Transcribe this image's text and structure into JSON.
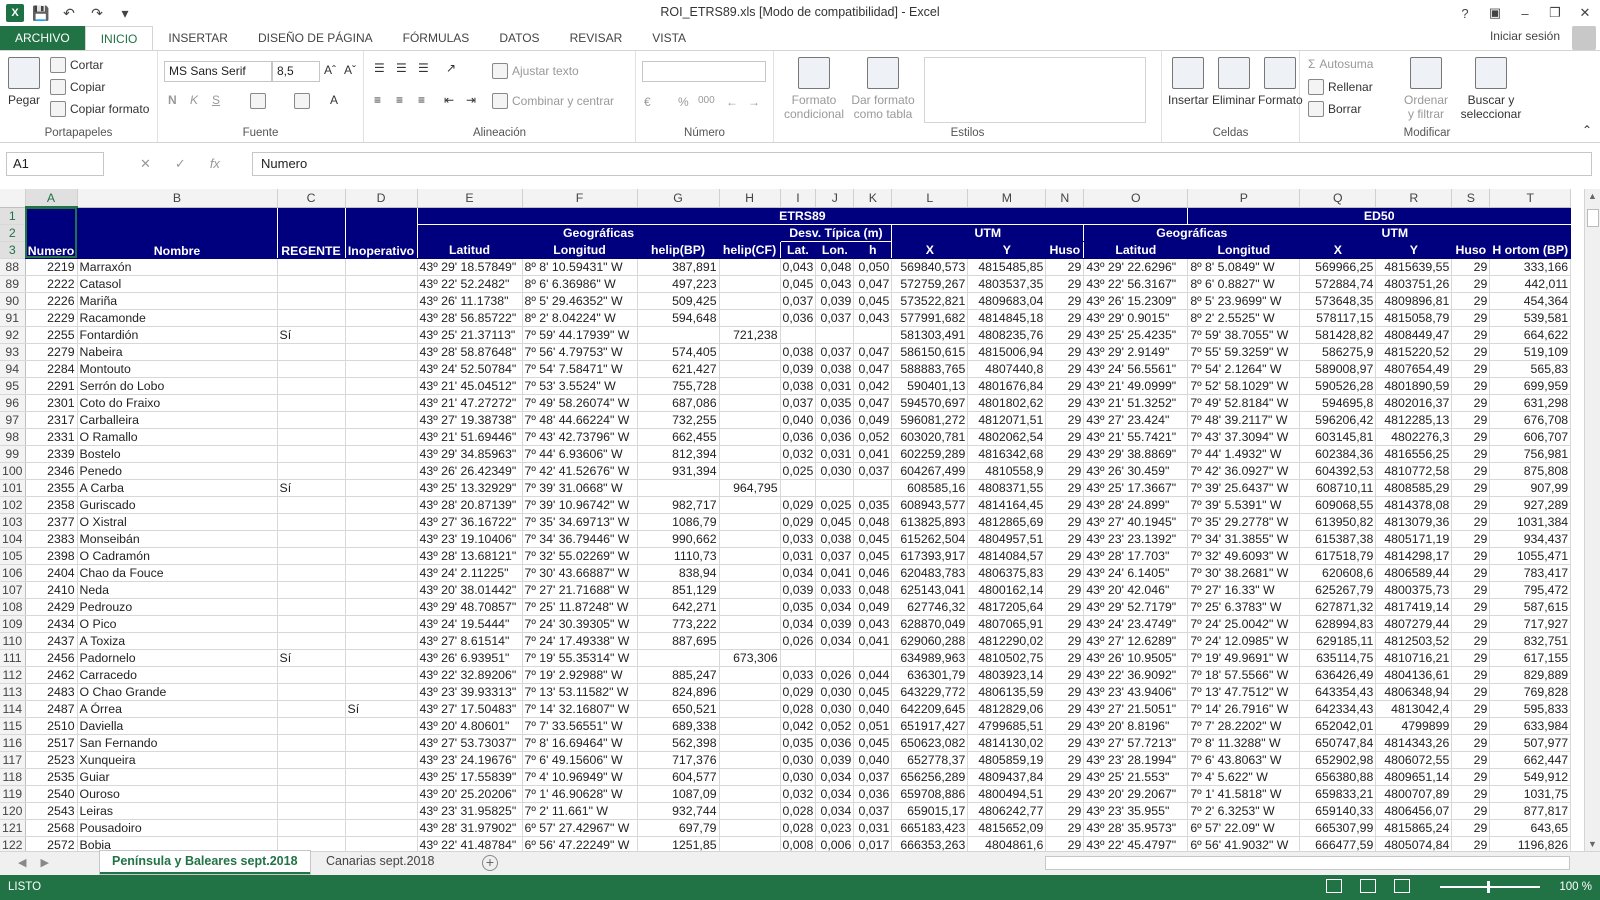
{
  "window": {
    "title": "ROI_ETRS89.xls  [Modo de compatibilidad] - Excel",
    "app_icon": "X"
  },
  "ribbon_tabs": [
    "ARCHIVO",
    "INICIO",
    "INSERTAR",
    "DISEÑO DE PÁGINA",
    "FÓRMULAS",
    "DATOS",
    "REVISAR",
    "VISTA"
  ],
  "signin": "Iniciar sesión",
  "ribbon": {
    "portapapeles": {
      "label": "Portapapeles",
      "pegar": "Pegar",
      "cortar": "Cortar",
      "copiar": "Copiar",
      "copiar_formato": "Copiar formato"
    },
    "fuente": {
      "label": "Fuente",
      "font": "MS Sans Serif",
      "size": "8,5",
      "bold": "N",
      "italic": "K",
      "underline": "S"
    },
    "alineacion": {
      "label": "Alineación",
      "ajustar": "Ajustar texto",
      "combinar": "Combinar y centrar"
    },
    "numero": {
      "label": "Número",
      "percent": "%",
      "thousands": "000"
    },
    "estilos": {
      "label": "Estilos",
      "formato_condicional": "Formato condicional",
      "dar_formato": "Dar formato como tabla"
    },
    "celdas": {
      "label": "Celdas",
      "insertar": "Insertar",
      "eliminar": "Eliminar",
      "formato": "Formato"
    },
    "modificar": {
      "label": "Modificar",
      "autosuma": "Autosuma",
      "rellenar": "Rellenar",
      "borrar": "Borrar",
      "ordenar": "Ordenar y filtrar",
      "buscar": "Buscar y seleccionar"
    }
  },
  "formula_bar": {
    "namebox": "A1",
    "formula": "Numero"
  },
  "columns": [
    "A",
    "B",
    "C",
    "D",
    "E",
    "F",
    "G",
    "H",
    "I",
    "J",
    "K",
    "L",
    "M",
    "N",
    "O",
    "P",
    "Q",
    "R",
    "S",
    "T"
  ],
  "header": {
    "row1": {
      "etrs": "ETRS89",
      "ed": "ED50"
    },
    "row2": {
      "geo1": "Geográficas",
      "desv": "Desv. Típica (m)",
      "utm1": "UTM",
      "geo2": "Geográficas",
      "utm2": "UTM"
    },
    "row3": [
      "Numero",
      "Nombre",
      "REGENTE",
      "Inoperativo",
      "Latitud",
      "Longitud",
      "helip(BP)",
      "helip(CF)",
      "Lat.",
      "Lon.",
      "h",
      "X",
      "Y",
      "Huso",
      "Latitud",
      "Longitud",
      "X",
      "Y",
      "Huso",
      "H ortom (BP)"
    ]
  },
  "rows": [
    [
      88,
      "2219",
      "Marraxón",
      "",
      "",
      "43º 29' 18.57849\"",
      "8º 8' 10.59431\" W",
      "387,891",
      "",
      "0,043",
      "0,048",
      "0,050",
      "569840,573",
      "4815485,85",
      "29",
      "43º 29' 22.6296\"",
      "8º 8' 5.0849\" W",
      "569966,25",
      "4815639,55",
      "29",
      "333,166"
    ],
    [
      89,
      "2222",
      "Catasol",
      "",
      "",
      "43º 22' 52.2482\"",
      "8º 6' 6.36986\" W",
      "497,223",
      "",
      "0,045",
      "0,043",
      "0,047",
      "572759,267",
      "4803537,35",
      "29",
      "43º 22' 56.3167\"",
      "8º 6' 0.8827\" W",
      "572884,74",
      "4803751,26",
      "29",
      "442,011"
    ],
    [
      90,
      "2226",
      "Mariña",
      "",
      "",
      "43º 26' 11.1738\"",
      "8º 5' 29.46352\" W",
      "509,425",
      "",
      "0,037",
      "0,039",
      "0,045",
      "573522,821",
      "4809683,04",
      "29",
      "43º 26' 15.2309\"",
      "8º 5' 23.9699\" W",
      "573648,35",
      "4809896,81",
      "29",
      "454,364"
    ],
    [
      91,
      "2229",
      "Racamonde",
      "",
      "",
      "43º 28' 56.85722\"",
      "8º 2' 8.04224\" W",
      "594,648",
      "",
      "0,036",
      "0,037",
      "0,043",
      "577991,682",
      "4814845,18",
      "29",
      "43º 29' 0.9015\"",
      "8º 2' 2.5525\" W",
      "578117,15",
      "4815058,79",
      "29",
      "539,581"
    ],
    [
      92,
      "2255",
      "Fontardión",
      "Sí",
      "",
      "43º 25' 21.37113\"",
      "7º 59' 44.17939\" W",
      "",
      "721,238",
      "",
      "",
      "",
      "581303,491",
      "4808235,76",
      "29",
      "43º 25' 25.4235\"",
      "7º 59' 38.7055\" W",
      "581428,82",
      "4808449,47",
      "29",
      "664,622"
    ],
    [
      93,
      "2279",
      "Nabeira",
      "",
      "",
      "43º 28' 58.87648\"",
      "7º 56' 4.79753\" W",
      "574,405",
      "",
      "0,038",
      "0,037",
      "0,047",
      "586150,615",
      "4815006,94",
      "29",
      "43º 29' 2.9149\"",
      "7º 55' 59.3259\" W",
      "586275,9",
      "4815220,52",
      "29",
      "519,109"
    ],
    [
      94,
      "2284",
      "Montouto",
      "",
      "",
      "43º 24' 52.50784\"",
      "7º 54' 7.58471\" W",
      "621,427",
      "",
      "0,039",
      "0,038",
      "0,047",
      "588883,765",
      "4807440,8",
      "29",
      "43º 24' 56.5561\"",
      "7º 54' 2.1264\" W",
      "589008,97",
      "4807654,49",
      "29",
      "565,83"
    ],
    [
      95,
      "2291",
      "Serrón do Lobo",
      "",
      "",
      "43º 21' 45.04512\"",
      "7º 53' 3.5524\" W",
      "755,728",
      "",
      "0,038",
      "0,031",
      "0,042",
      "590401,13",
      "4801676,84",
      "29",
      "43º 21' 49.0999\"",
      "7º 52' 58.1029\" W",
      "590526,28",
      "4801890,59",
      "29",
      "699,959"
    ],
    [
      96,
      "2301",
      "Coto do Fraixo",
      "",
      "",
      "43º 21' 47.27272\"",
      "7º 49' 58.26074\" W",
      "687,086",
      "",
      "0,037",
      "0,035",
      "0,047",
      "594570,697",
      "4801802,62",
      "29",
      "43º 21' 51.3252\"",
      "7º 49' 52.8184\" W",
      "594695,8",
      "4802016,37",
      "29",
      "631,298"
    ],
    [
      97,
      "2317",
      "Carballeira",
      "",
      "",
      "43º 27' 19.38738\"",
      "7º 48' 44.66224\" W",
      "732,255",
      "",
      "0,040",
      "0,036",
      "0,049",
      "596081,272",
      "4812071,51",
      "29",
      "43º 27' 23.424\"",
      "7º 48' 39.2117\" W",
      "596206,42",
      "4812285,13",
      "29",
      "676,708"
    ],
    [
      98,
      "2331",
      "O Ramallo",
      "",
      "",
      "43º 21' 51.69446\"",
      "7º 43' 42.73796\" W",
      "662,455",
      "",
      "0,036",
      "0,036",
      "0,052",
      "603020,781",
      "4802062,54",
      "29",
      "43º 21' 55.7421\"",
      "7º 43' 37.3094\" W",
      "603145,81",
      "4802276,3",
      "29",
      "606,707"
    ],
    [
      99,
      "2339",
      "Bostelo",
      "",
      "",
      "43º 29' 34.85963\"",
      "7º 44' 6.93606\" W",
      "812,394",
      "",
      "0,032",
      "0,031",
      "0,041",
      "602259,289",
      "4816342,68",
      "29",
      "43º 29' 38.8869\"",
      "7º 44' 1.4932\" W",
      "602384,36",
      "4816556,25",
      "29",
      "756,981"
    ],
    [
      100,
      "2346",
      "Penedo",
      "",
      "",
      "43º 26' 26.42349\"",
      "7º 42' 41.52676\" W",
      "931,394",
      "",
      "0,025",
      "0,030",
      "0,037",
      "604267,499",
      "4810558,9",
      "29",
      "43º 26' 30.459\"",
      "7º 42' 36.0927\" W",
      "604392,53",
      "4810772,58",
      "29",
      "875,808"
    ],
    [
      101,
      "2355",
      "A Carba",
      "Sí",
      "",
      "43º 25' 13.32929\"",
      "7º 39' 31.0668\" W",
      "",
      "964,795",
      "",
      "",
      "",
      "608585,16",
      "4808371,55",
      "29",
      "43º 25' 17.3667\"",
      "7º 39' 25.6437\" W",
      "608710,11",
      "4808585,29",
      "29",
      "907,99"
    ],
    [
      102,
      "2358",
      "Guriscado",
      "",
      "",
      "43º 28' 20.87139\"",
      "7º 39' 10.96742\" W",
      "982,717",
      "",
      "0,029",
      "0,025",
      "0,035",
      "608943,577",
      "4814164,45",
      "29",
      "43º 28' 24.899\"",
      "7º 39' 5.5391\" W",
      "609068,55",
      "4814378,08",
      "29",
      "927,289"
    ],
    [
      103,
      "2377",
      "O Xistral",
      "",
      "",
      "43º 27' 36.16722\"",
      "7º 35' 34.69713\" W",
      "1086,79",
      "",
      "0,029",
      "0,045",
      "0,048",
      "613825,893",
      "4812865,69",
      "29",
      "43º 27' 40.1945\"",
      "7º 35' 29.2778\" W",
      "613950,82",
      "4813079,36",
      "29",
      "1031,384"
    ],
    [
      104,
      "2383",
      "Monseibán",
      "",
      "",
      "43º 23' 19.10406\"",
      "7º 34' 36.79446\" W",
      "990,662",
      "",
      "0,033",
      "0,038",
      "0,045",
      "615262,504",
      "4804957,51",
      "29",
      "43º 23' 23.1392\"",
      "7º 34' 31.3855\" W",
      "615387,38",
      "4805171,19",
      "29",
      "934,437"
    ],
    [
      105,
      "2398",
      "O Cadramón",
      "",
      "",
      "43º 28' 13.68121\"",
      "7º 32' 55.02269\" W",
      "1110,73",
      "",
      "0,031",
      "0,037",
      "0,045",
      "617393,917",
      "4814084,57",
      "29",
      "43º 28' 17.703\"",
      "7º 32' 49.6093\" W",
      "617518,79",
      "4814298,17",
      "29",
      "1055,471"
    ],
    [
      106,
      "2404",
      "Chao da Fouce",
      "",
      "",
      "43º 24' 2.11225\"",
      "7º 30' 43.66887\" W",
      "838,94",
      "",
      "0,034",
      "0,041",
      "0,046",
      "620483,783",
      "4806375,83",
      "29",
      "43º 24' 6.1405\"",
      "7º 30' 38.2681\" W",
      "620608,6",
      "4806589,44",
      "29",
      "783,417"
    ],
    [
      107,
      "2410",
      "Neda",
      "",
      "",
      "43º 20' 38.01442\"",
      "7º 27' 21.71688\" W",
      "851,129",
      "",
      "0,039",
      "0,033",
      "0,048",
      "625143,041",
      "4800162,14",
      "29",
      "43º 20' 42.046\"",
      "7º 27' 16.33\" W",
      "625267,79",
      "4800375,73",
      "29",
      "795,472"
    ],
    [
      108,
      "2429",
      "Pedrouzo",
      "",
      "",
      "43º 29' 48.70857\"",
      "7º 25' 11.87248\" W",
      "642,271",
      "",
      "0,035",
      "0,034",
      "0,049",
      "627746,32",
      "4817205,64",
      "29",
      "43º 29' 52.7179\"",
      "7º 25' 6.3783\" W",
      "627871,32",
      "4817419,14",
      "29",
      "587,615"
    ],
    [
      109,
      "2434",
      "O Pico",
      "",
      "",
      "43º 24' 19.5444\"",
      "7º 24' 30.39305\" W",
      "773,222",
      "",
      "0,034",
      "0,039",
      "0,043",
      "628870,049",
      "4807065,91",
      "29",
      "43º 24' 23.4749\"",
      "7º 24' 25.0042\" W",
      "628994,83",
      "4807279,44",
      "29",
      "717,927"
    ],
    [
      110,
      "2437",
      "A Toxiza",
      "",
      "",
      "43º 27' 8.61514\"",
      "7º 24' 17.49338\" W",
      "887,695",
      "",
      "0,026",
      "0,034",
      "0,041",
      "629060,288",
      "4812290,02",
      "29",
      "43º 27' 12.6289\"",
      "7º 24' 12.0985\" W",
      "629185,11",
      "4812503,52",
      "29",
      "832,751"
    ],
    [
      111,
      "2456",
      "Padornelo",
      "Sí",
      "",
      "43º 26' 6.93951\"",
      "7º 19' 55.35314\" W",
      "",
      "673,306",
      "",
      "",
      "",
      "634989,963",
      "4810502,75",
      "29",
      "43º 26' 10.9505\"",
      "7º 19' 49.9691\" W",
      "635114,75",
      "4810716,21",
      "29",
      "617,155"
    ],
    [
      112,
      "2462",
      "Carracedo",
      "",
      "",
      "43º 22' 32.89206\"",
      "7º 19' 2.92988\" W",
      "885,247",
      "",
      "0,033",
      "0,026",
      "0,044",
      "636301,79",
      "4803923,14",
      "29",
      "43º 22' 36.9092\"",
      "7º 18' 57.5566\" W",
      "636426,49",
      "4804136,61",
      "29",
      "829,889"
    ],
    [
      113,
      "2483",
      "O Chao Grande",
      "",
      "",
      "43º 23' 39.93313\"",
      "7º 13' 53.11582\" W",
      "824,896",
      "",
      "0,029",
      "0,030",
      "0,045",
      "643229,772",
      "4806135,59",
      "29",
      "43º 23' 43.9406\"",
      "7º 13' 47.7512\" W",
      "643354,43",
      "4806348,94",
      "29",
      "769,828"
    ],
    [
      114,
      "2487",
      "A Órrea",
      "",
      "Sí",
      "43º 27' 17.50483\"",
      "7º 14' 32.16807\" W",
      "650,521",
      "",
      "0,028",
      "0,030",
      "0,040",
      "642209,645",
      "4812829,06",
      "29",
      "43º 27' 21.5051\"",
      "7º 14' 26.7916\" W",
      "642334,43",
      "4813042,4",
      "29",
      "595,833"
    ],
    [
      115,
      "2510",
      "Daviella",
      "",
      "",
      "43º 20' 4.80601\"",
      "7º 7' 33.56551\" W",
      "689,338",
      "",
      "0,042",
      "0,052",
      "0,051",
      "651917,427",
      "4799685,51",
      "29",
      "43º 20' 8.8196\"",
      "7º 7' 28.2202\" W",
      "652042,01",
      "4799899",
      "29",
      "633,984"
    ],
    [
      116,
      "2517",
      "San Fernando",
      "",
      "",
      "43º 27' 53.73037\"",
      "7º 8' 16.69464\" W",
      "562,398",
      "",
      "0,035",
      "0,036",
      "0,045",
      "650623,082",
      "4814130,02",
      "29",
      "43º 27' 57.7213\"",
      "7º 8' 11.3288\" W",
      "650747,84",
      "4814343,26",
      "29",
      "507,977"
    ],
    [
      117,
      "2523",
      "Xunqueira",
      "",
      "",
      "43º 23' 24.19676\"",
      "7º 6' 49.15606\" W",
      "717,376",
      "",
      "0,030",
      "0,039",
      "0,040",
      "652778,37",
      "4805859,19",
      "29",
      "43º 23' 28.1994\"",
      "7º 6' 43.8063\" W",
      "652902,98",
      "4806072,55",
      "29",
      "662,447"
    ],
    [
      118,
      "2535",
      "Guiar",
      "",
      "",
      "43º 25' 17.55839\"",
      "7º 4' 10.96949\" W",
      "604,577",
      "",
      "0,030",
      "0,034",
      "0,037",
      "656256,289",
      "4809437,84",
      "29",
      "43º 25' 21.553\"",
      "7º 4' 5.622\" W",
      "656380,88",
      "4809651,14",
      "29",
      "549,912"
    ],
    [
      119,
      "2540",
      "Ouroso",
      "",
      "",
      "43º 20' 25.20206\"",
      "7º 1' 46.90628\" W",
      "1087,09",
      "",
      "0,032",
      "0,034",
      "0,036",
      "659708,886",
      "4800494,51",
      "29",
      "43º 20' 29.2067\"",
      "7º 1' 41.5818\" W",
      "659833,21",
      "4800707,89",
      "29",
      "1031,75"
    ],
    [
      120,
      "2543",
      "Leiras",
      "",
      "",
      "43º 23' 31.95825\"",
      "7º 2' 11.661\" W",
      "932,744",
      "",
      "0,028",
      "0,034",
      "0,037",
      "659015,17",
      "4806242,77",
      "29",
      "43º 23' 35.955\"",
      "7º 2' 6.3253\" W",
      "659140,33",
      "4806456,07",
      "29",
      "877,817"
    ],
    [
      121,
      "2568",
      "Pousadoiro",
      "",
      "",
      "43º 28' 31.97902\"",
      "6º 57' 27.42967\" W",
      "697,79",
      "",
      "0,028",
      "0,023",
      "0,031",
      "665183,423",
      "4815652,09",
      "29",
      "43º 28' 35.9573\"",
      "6º 57' 22.09\" W",
      "665307,99",
      "4815865,24",
      "29",
      "643,65"
    ],
    [
      122,
      "2572",
      "Bobia",
      "",
      "",
      "43º 22' 41.48784\"",
      "6º 56' 47.22249\" W",
      "1251,85",
      "",
      "0,008",
      "0,006",
      "0,017",
      "666353,263",
      "4804861,6",
      "29",
      "43º 22' 45.4797\"",
      "6º 56' 41.9032\" W",
      "666477,59",
      "4805074,84",
      "29",
      "1196,826"
    ]
  ],
  "sheets": [
    "Península y Baleares sept.2018",
    "Canarias sept.2018"
  ],
  "status": {
    "ready": "LISTO",
    "zoom": "100 %"
  },
  "colors": {
    "excel_green": "#217346",
    "header_blue": "#00007f"
  }
}
